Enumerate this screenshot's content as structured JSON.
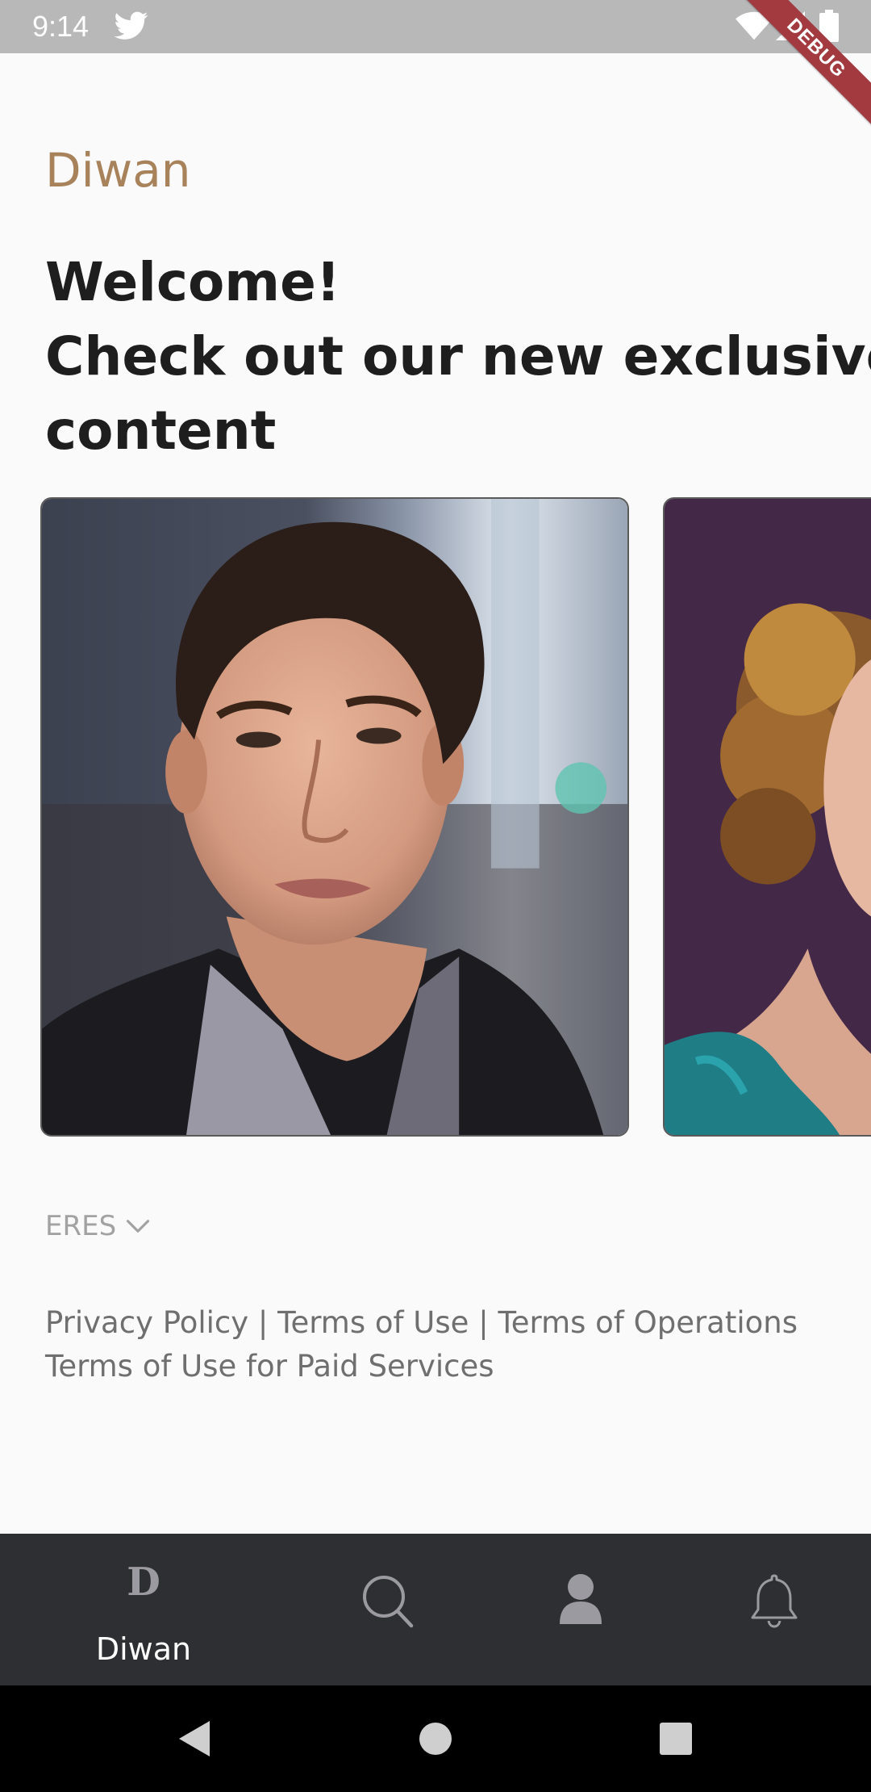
{
  "status_bar": {
    "time": "9:14",
    "icons": [
      "twitter-icon",
      "wifi-icon",
      "signal-icon",
      "battery-icon"
    ]
  },
  "debug_banner": "DEBUG",
  "header": {
    "brand": "Diwan",
    "headline_lines": [
      "Welcome!",
      "Check out our new exclusive",
      "content"
    ]
  },
  "carousel": {
    "cards": [
      {
        "subject": "portrait-young-man"
      },
      {
        "subject": "portrait-curly-hair-woman"
      }
    ]
  },
  "language_selector": {
    "value": "ERES",
    "icon": "chevron-down-icon"
  },
  "footer": {
    "privacy_policy": "Privacy Policy",
    "terms_of_use": "Terms of Use",
    "terms_of_operations": "Terms of Operations",
    "terms_paid_services": "Terms of Use for Paid Services",
    "separator": "|"
  },
  "bottom_nav": {
    "home_logo": "D",
    "home_label": "Diwan",
    "items": [
      "home",
      "search-icon",
      "profile-icon",
      "bell-icon"
    ]
  },
  "colors": {
    "brand": "#a8825a",
    "nav_background": "#2e2f33",
    "status_bar": "#b8b8b8",
    "debug": "#a23a3f"
  }
}
